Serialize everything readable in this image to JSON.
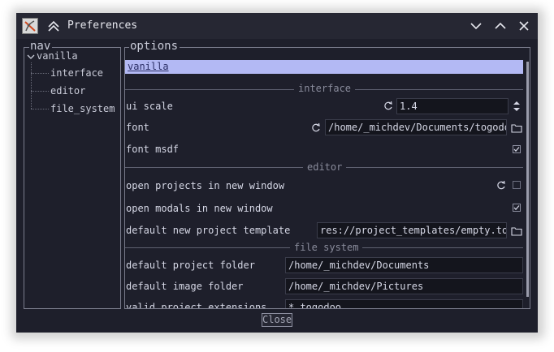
{
  "window": {
    "title": "Preferences"
  },
  "nav": {
    "legend": "nav",
    "root": {
      "label": "vanilla"
    },
    "items": [
      {
        "label": "interface"
      },
      {
        "label": "editor"
      },
      {
        "label": "file_system"
      }
    ]
  },
  "options": {
    "legend": "options",
    "selected": "vanilla",
    "sections": {
      "interface": {
        "title": "interface",
        "ui_scale": {
          "label": "ui scale",
          "value": "1.4"
        },
        "font": {
          "label": "font",
          "value": "/home/_michdev/Documents/togodoo"
        },
        "font_msdf": {
          "label": "font msdf",
          "checked": true
        }
      },
      "editor": {
        "title": "editor",
        "open_projects": {
          "label": "open projects in new window",
          "checked": false
        },
        "open_modals": {
          "label": "open modals in new window",
          "checked": true
        },
        "template": {
          "label": "default new project template",
          "value": "res://project_templates/empty.togo"
        }
      },
      "file_system": {
        "title": "file system",
        "project_folder": {
          "label": "default project folder",
          "value": "/home/_michdev/Documents"
        },
        "image_folder": {
          "label": "default image folder",
          "value": "/home/_michdev/Pictures"
        },
        "extensions": {
          "label": "valid project extensions",
          "value": "*.togodoo"
        }
      }
    }
  },
  "footer": {
    "close_label": "Close"
  },
  "colors": {
    "selection": "#b3b9f4",
    "background": "#1e1f2b",
    "titlebar": "#262733"
  }
}
